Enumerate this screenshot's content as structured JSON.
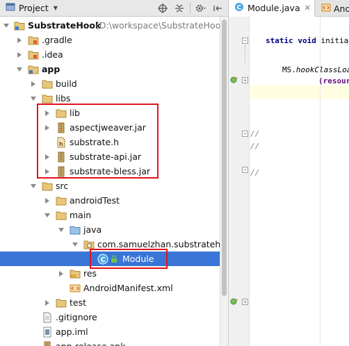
{
  "panel": {
    "view_selector": "Project",
    "toolbar_icons": [
      "target-icon",
      "collapse-all-icon",
      "gear-icon",
      "hide-panel-icon"
    ]
  },
  "tree": {
    "root": {
      "label": "SubstrateHook",
      "path_hint": "(D:\\workspace\\SubstrateHook)"
    },
    "gradle": ".gradle",
    "idea": ".idea",
    "app": "app",
    "build": "build",
    "libs": "libs",
    "lib": "lib",
    "aspectjweaver": "aspectjweaver.jar",
    "substrate_h": "substrate.h",
    "substrate_api": "substrate-api.jar",
    "substrate_bless": "substrate-bless.jar",
    "src": "src",
    "android_test": "androidTest",
    "main": "main",
    "java": "java",
    "package": "com.samuelzhan.substratehook",
    "module": "Module",
    "res": "res",
    "manifest": "AndroidManifest.xml",
    "test": "test",
    "gitignore": ".gitignore",
    "app_iml": "app.iml",
    "app_release": "app-release.apk"
  },
  "editor": {
    "tabs": [
      {
        "label": "Module.java",
        "active": true
      },
      {
        "label": "And",
        "active": false
      }
    ],
    "code": {
      "line1_kw": "static void",
      "line1_rest": " initial",
      "line2_cls": "MS.",
      "line2_call": "hookClassLoad",
      "line3": "(resour",
      "comment1": "//",
      "comment2": "//",
      "comment3": "//"
    }
  },
  "colors": {
    "selection": "#3875d7",
    "highlight_box": "#e3121c",
    "folder": "#e8c77a",
    "jar": "#c9a86b"
  }
}
